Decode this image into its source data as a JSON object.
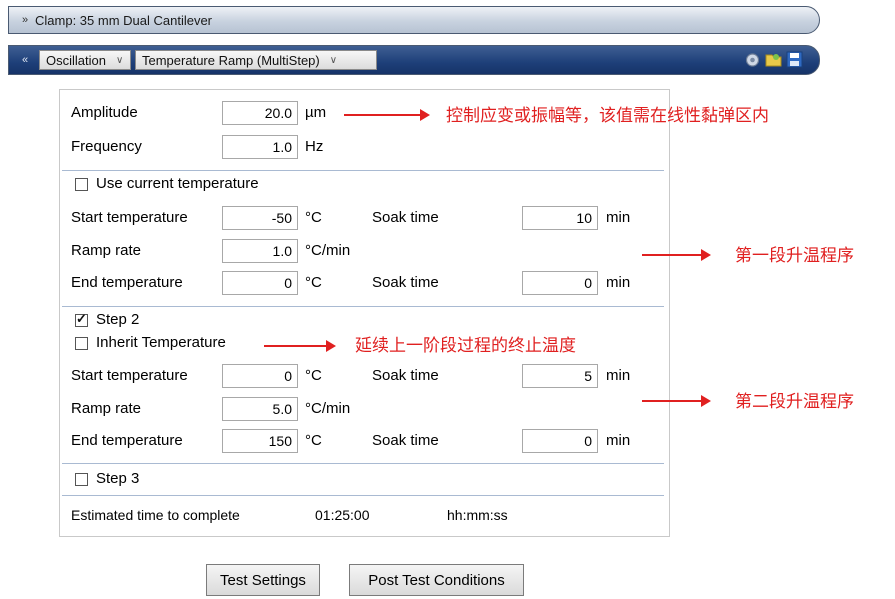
{
  "header": {
    "clamp_title": "Clamp: 35 mm Dual Cantilever",
    "mode_dropdown": "Oscillation",
    "test_dropdown": "Temperature Ramp (MultiStep)"
  },
  "params": {
    "amplitude_label": "Amplitude",
    "amplitude_value": "20.0",
    "amplitude_unit": "µm",
    "frequency_label": "Frequency",
    "frequency_value": "1.0",
    "frequency_unit": "Hz"
  },
  "use_current_temp_label": "Use current temperature",
  "step1": {
    "start_label": "Start temperature",
    "start_value": "-50",
    "start_unit": "°C",
    "soak1_label": "Soak time",
    "soak1_value": "10",
    "soak1_unit": "min",
    "ramp_label": "Ramp rate",
    "ramp_value": "1.0",
    "ramp_unit": "°C/min",
    "end_label": "End temperature",
    "end_value": "0",
    "end_unit": "°C",
    "soak2_label": "Soak time",
    "soak2_value": "0",
    "soak2_unit": "min"
  },
  "step2": {
    "enable_label": "Step 2",
    "enabled": true,
    "inherit_label": "Inherit Temperature",
    "inherit_checked": false,
    "start_label": "Start temperature",
    "start_value": "0",
    "start_unit": "°C",
    "soak1_label": "Soak time",
    "soak1_value": "5",
    "soak1_unit": "min",
    "ramp_label": "Ramp rate",
    "ramp_value": "5.0",
    "ramp_unit": "°C/min",
    "end_label": "End temperature",
    "end_value": "150",
    "end_unit": "°C",
    "soak2_label": "Soak time",
    "soak2_value": "0",
    "soak2_unit": "min"
  },
  "step3": {
    "enable_label": "Step 3",
    "enabled": false
  },
  "estimate": {
    "label": "Estimated time to complete",
    "value": "01:25:00",
    "format": "hh:mm:ss"
  },
  "buttons": {
    "test_settings": "Test Settings",
    "post_test": "Post Test Conditions"
  },
  "annotations": {
    "amplitude_note": "控制应变或振幅等，该值需在线性黏弹区内",
    "step1_note": "第一段升温程序",
    "inherit_note": "延续上一阶段过程的终止温度",
    "step2_note": "第二段升温程序"
  },
  "colors": {
    "annotation": "#e02020",
    "header_blue": "#1e3f79",
    "separator": "#a9bad2"
  }
}
